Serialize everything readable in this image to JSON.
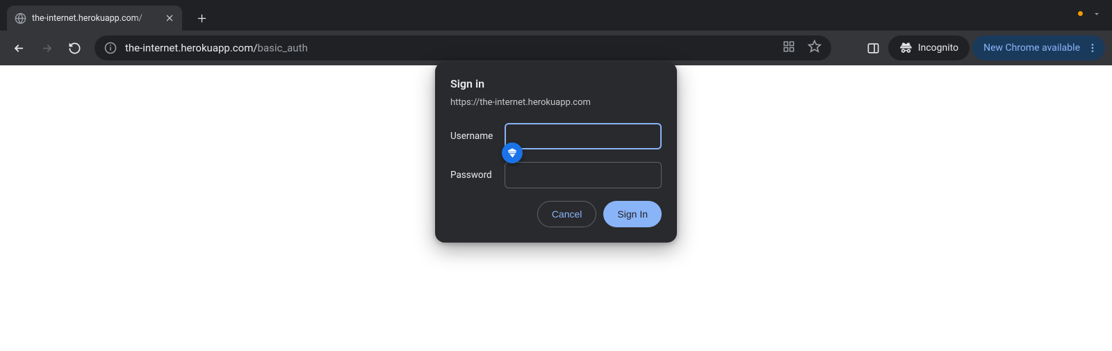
{
  "tab": {
    "title": "the-internet.herokuapp.com/",
    "close_aria": "Close tab"
  },
  "toolbar": {
    "new_tab_aria": "New tab",
    "back_aria": "Back",
    "forward_aria": "Forward",
    "reload_aria": "Reload",
    "url_host": "the-internet.herokuapp.com/",
    "url_path": "basic_auth",
    "incognito_label": "Incognito",
    "update_label": "New Chrome available"
  },
  "dialog": {
    "title": "Sign in",
    "origin": "https://the-internet.herokuapp.com",
    "username_label": "Username",
    "password_label": "Password",
    "username_value": "",
    "password_value": "",
    "cancel_label": "Cancel",
    "submit_label": "Sign In"
  }
}
